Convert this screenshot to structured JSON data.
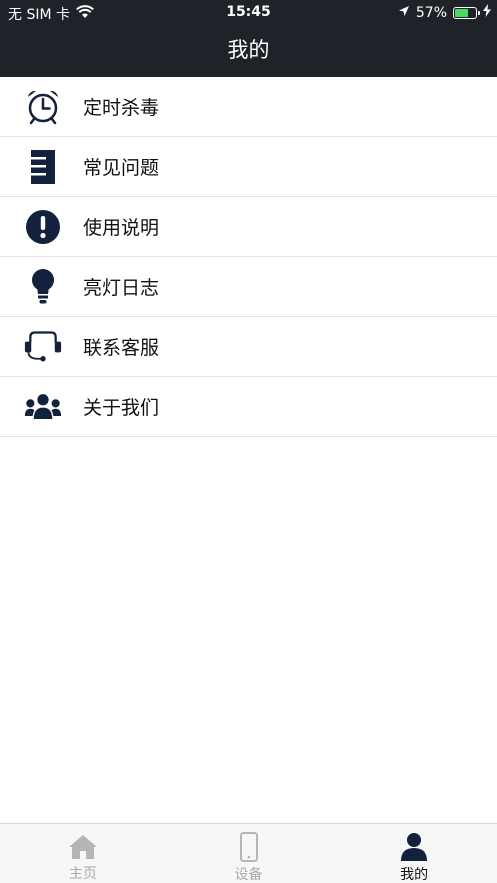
{
  "status_bar": {
    "carrier": "无 SIM 卡",
    "time": "15:45",
    "battery_text": "57%",
    "battery_level": 0.57,
    "battery_color": "#4cd964"
  },
  "header": {
    "title": "我的",
    "background": "#1f2228"
  },
  "menu": {
    "icon_color": "#13213d",
    "items": [
      {
        "label": "定时杀毒",
        "icon": "alarm-clock-icon"
      },
      {
        "label": "常见问题",
        "icon": "document-list-icon"
      },
      {
        "label": "使用说明",
        "icon": "exclamation-circle-icon"
      },
      {
        "label": "亮灯日志",
        "icon": "light-bulb-icon"
      },
      {
        "label": "联系客服",
        "icon": "headset-icon"
      },
      {
        "label": "关于我们",
        "icon": "group-icon"
      }
    ]
  },
  "tabbar": {
    "items": [
      {
        "label": "主页",
        "icon": "home-icon",
        "active": false
      },
      {
        "label": "设备",
        "icon": "phone-icon",
        "active": false
      },
      {
        "label": "我的",
        "icon": "user-icon",
        "active": true
      }
    ]
  }
}
